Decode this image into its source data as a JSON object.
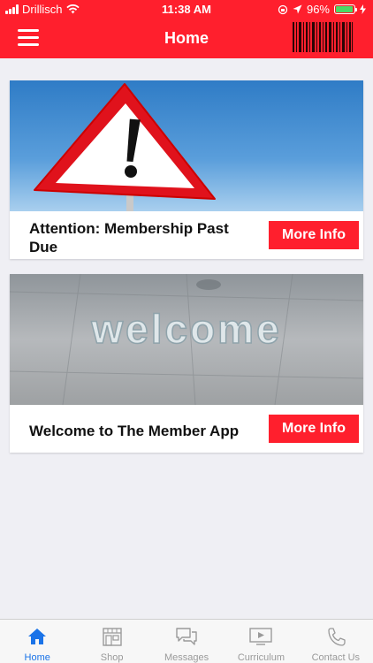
{
  "status": {
    "carrier": "Drillisch",
    "time": "11:38 AM",
    "battery": "96%",
    "battery_level": 0.96
  },
  "header": {
    "title": "Home",
    "menu_icon": "hamburger-menu-icon",
    "barcode_icon": "barcode-icon"
  },
  "cards": [
    {
      "image": "warning-sign-image",
      "title": "Attention: Membership Past Due",
      "button": "More Info"
    },
    {
      "image": "welcome-image",
      "title": "Welcome to The Member App",
      "button": "More Info",
      "image_text": "welcome"
    }
  ],
  "tabs": [
    {
      "label": "Home",
      "icon": "home-icon",
      "active": true
    },
    {
      "label": "Shop",
      "icon": "shop-icon"
    },
    {
      "label": "Messages",
      "icon": "messages-icon"
    },
    {
      "label": "Curriculum",
      "icon": "video-icon"
    },
    {
      "label": "Contact Us",
      "icon": "phone-icon"
    }
  ],
  "colors": {
    "brand": "#ff1f2d",
    "active_tab": "#1a73e8",
    "background": "#efeff4"
  }
}
